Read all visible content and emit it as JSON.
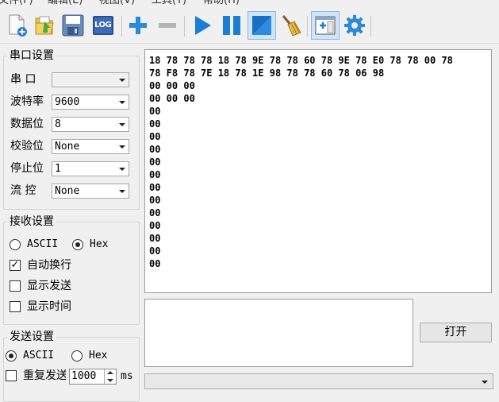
{
  "menu": [
    "文件(F)",
    "编辑(E)",
    "视图(V)",
    "工具(T)",
    "帮助(H)"
  ],
  "toolbar": {
    "log_label": "LOG",
    "icons": [
      "new-file-icon",
      "open-folder-icon",
      "save-icon",
      "log-icon",
      "add-icon",
      "remove-icon",
      "play-icon",
      "pause-icon",
      "stop-icon",
      "clear-broom-icon",
      "window-add-icon",
      "settings-gear-icon"
    ]
  },
  "serial": {
    "title": "串口设置",
    "port_label": "串  口",
    "port_value": "",
    "baud_label": "波特率",
    "baud_value": "9600",
    "data_label": "数据位",
    "data_value": "8",
    "parity_label": "校验位",
    "parity_value": "None",
    "stop_label": "停止位",
    "stop_value": "1",
    "flow_label": "流  控",
    "flow_value": "None"
  },
  "receive": {
    "title": "接收设置",
    "ascii_label": "ASCII",
    "hex_label": "Hex",
    "mode_selected": "Hex",
    "auto_wrap_label": "自动换行",
    "auto_wrap": true,
    "show_send_label": "显示发送",
    "show_send": false,
    "show_time_label": "显示时间",
    "show_time": false
  },
  "send": {
    "title": "发送设置",
    "ascii_label": "ASCII",
    "hex_label": "Hex",
    "mode_selected": "ASCII",
    "repeat_label": "重复发送",
    "repeat": false,
    "interval_value": "1000",
    "interval_unit": "ms",
    "text": ""
  },
  "receive_text": "18 78 78 78 18 78 9E 78 78 60 78 9E 78 E0 78 78 00 78\n78 F8 78 7E 18 78 1E 98 78 78 60 78 06 98\n00 00 00\n00 00 00\n00\n00\n00\n00\n00\n00\n00\n00\n00\n00\n00\n00\n00",
  "open_button_label": "打开",
  "colors": {
    "accent_blue": "#1a7fd4",
    "background": "#f0f0f0",
    "text_bg": "#ffffff"
  }
}
